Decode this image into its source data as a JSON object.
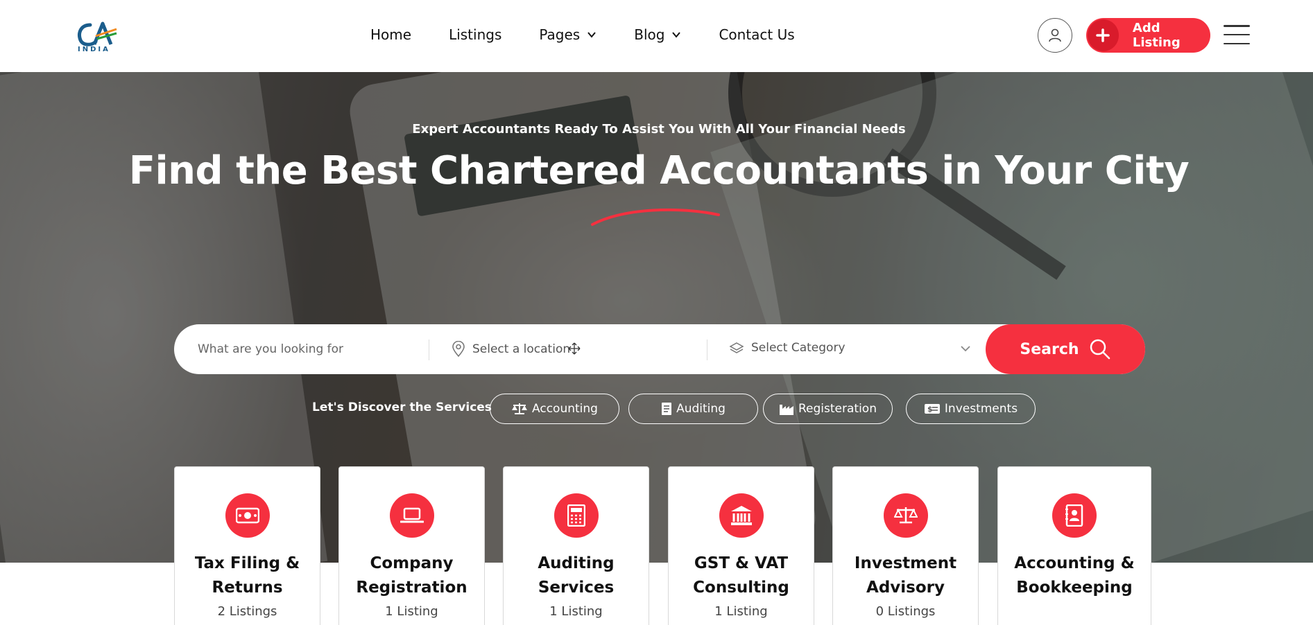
{
  "header": {
    "logo_letters": "CA",
    "logo_sub": "INDIA",
    "nav": [
      {
        "label": "Home",
        "has_dropdown": false
      },
      {
        "label": "Listings",
        "has_dropdown": false
      },
      {
        "label": "Pages",
        "has_dropdown": true
      },
      {
        "label": "Blog",
        "has_dropdown": true
      },
      {
        "label": "Contact Us",
        "has_dropdown": false
      }
    ],
    "user_icon": "user-icon",
    "add_listing_label": "Add Listing",
    "menu_icon": "hamburger-icon"
  },
  "hero": {
    "subtitle": "Expert Accountants Ready To Assist You With All Your Financial Needs",
    "title": "Find the Best Chartered Accountants in Your City"
  },
  "search": {
    "keyword_placeholder": "What are you looking for",
    "location_placeholder": "Select a location",
    "category_label": "Select Category",
    "button_label": "Search"
  },
  "discover": {
    "label": "Let's Discover the Services",
    "services": [
      {
        "label": "Accounting",
        "icon": "scale-icon"
      },
      {
        "label": "Auditing",
        "icon": "document-icon"
      },
      {
        "label": "Registeration",
        "icon": "factory-icon"
      },
      {
        "label": "Investments",
        "icon": "money-icon"
      }
    ]
  },
  "categories": [
    {
      "title": "Tax Filing & Returns",
      "count": "2 Listings",
      "icon": "cash-icon"
    },
    {
      "title": "Company Registration",
      "count": "1 Listing",
      "icon": "laptop-icon"
    },
    {
      "title": "Auditing Services",
      "count": "1 Listing",
      "icon": "calculator-icon"
    },
    {
      "title": "GST & VAT Consulting",
      "count": "1 Listing",
      "icon": "bank-icon"
    },
    {
      "title": "Investment Advisory",
      "count": "0 Listings",
      "icon": "scale-icon"
    },
    {
      "title": "Accounting & Bookkeeping",
      "count": "",
      "icon": "contact-book-icon"
    }
  ],
  "colors": {
    "accent": "#f5303f",
    "accent_dark": "#d91b2b",
    "logo_blue": "#1b5d8c"
  }
}
